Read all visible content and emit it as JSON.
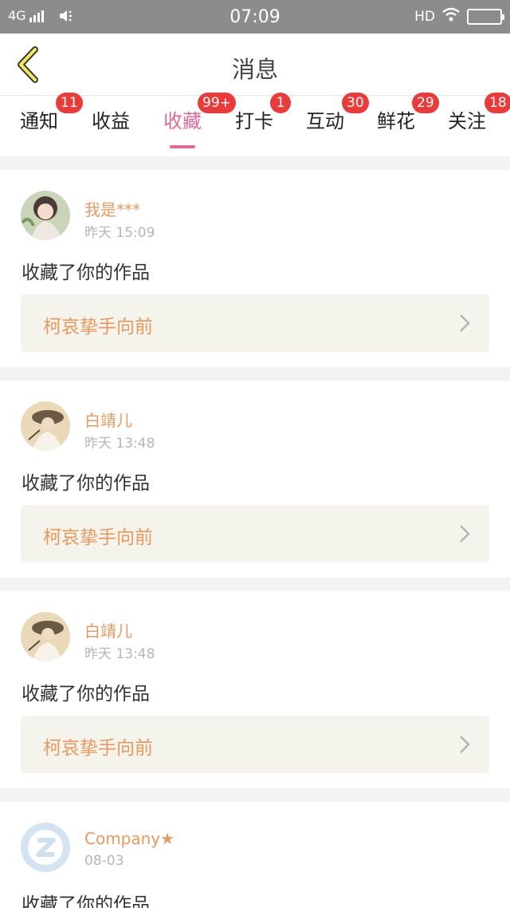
{
  "status_bar": {
    "network": "4G",
    "time": "07:09",
    "hd": "HD"
  },
  "nav": {
    "title": "消息",
    "back_icon": "chevron-left-icon"
  },
  "tabs": [
    {
      "label": "通知",
      "badge": "11"
    },
    {
      "label": "收益",
      "badge": ""
    },
    {
      "label": "收藏",
      "badge": "99+",
      "active": true
    },
    {
      "label": "打卡",
      "badge": "1"
    },
    {
      "label": "互动",
      "badge": "30"
    },
    {
      "label": "鲜花",
      "badge": "29"
    },
    {
      "label": "关注",
      "badge": "18"
    }
  ],
  "colors": {
    "accent": "#e0699a",
    "badge": "#ea3a3a",
    "username": "#e89a5e",
    "link_bg": "#f4f3ec"
  },
  "messages": [
    {
      "username": "我是***",
      "time": "昨天 15:09",
      "action": "收藏了你的作品",
      "work": "柯哀挚手向前"
    },
    {
      "username": "白靖儿",
      "time": "昨天 13:48",
      "action": "收藏了你的作品",
      "work": "柯哀挚手向前"
    },
    {
      "username": "白靖儿",
      "time": "昨天 13:48",
      "action": "收藏了你的作品",
      "work": "柯哀挚手向前"
    },
    {
      "username": "Company",
      "username_star": "★",
      "time": "08-03",
      "action": "收藏了你的作品",
      "work": ""
    }
  ]
}
